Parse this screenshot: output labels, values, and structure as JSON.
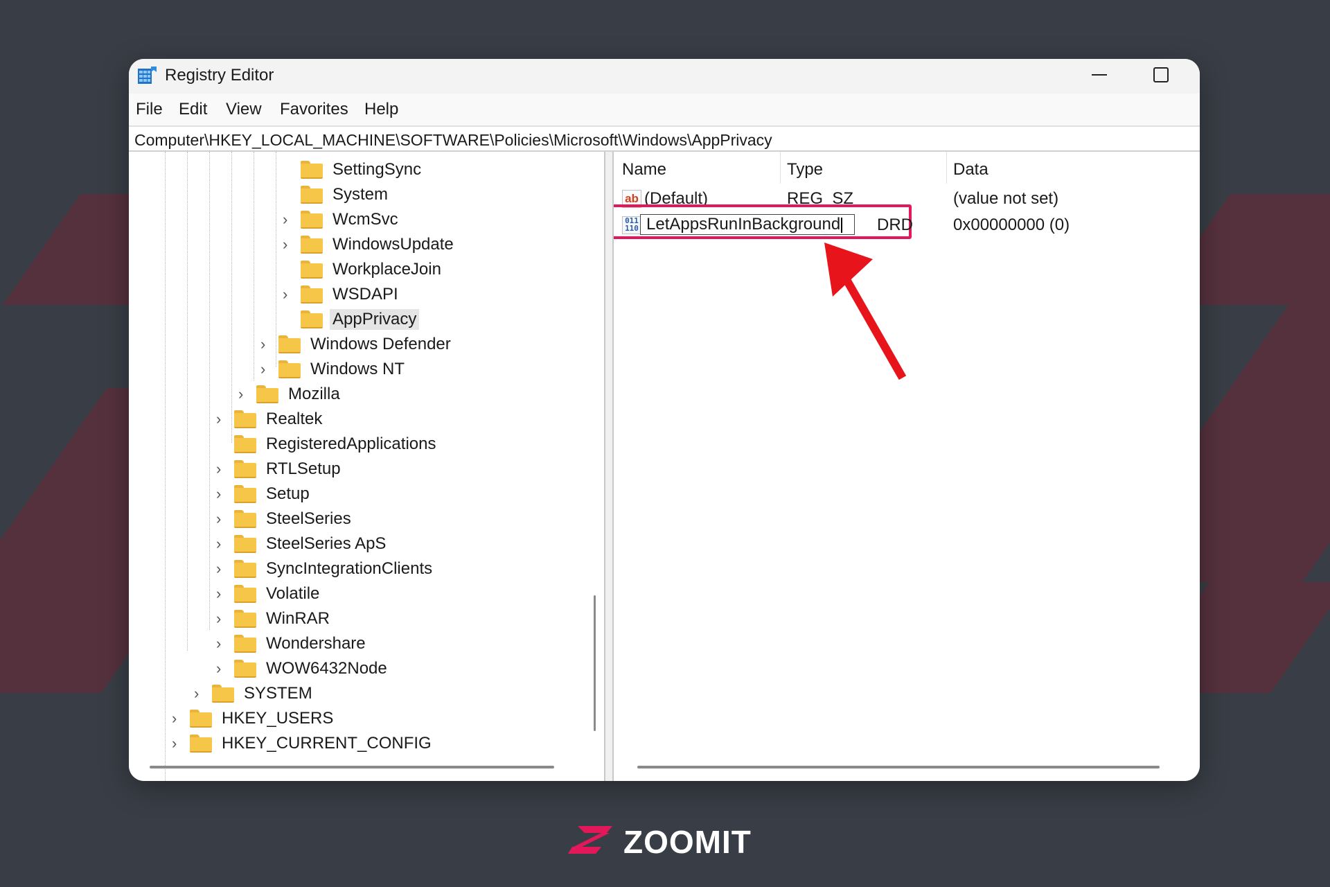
{
  "window": {
    "title": "Registry Editor"
  },
  "menu": [
    "File",
    "Edit",
    "View",
    "Favorites",
    "Help"
  ],
  "address": "Computer\\HKEY_LOCAL_MACHINE\\SOFTWARE\\Policies\\Microsoft\\Windows\\AppPrivacy",
  "tree": [
    {
      "label": "SettingSync",
      "expandable": false
    },
    {
      "label": "System",
      "expandable": false
    },
    {
      "label": "WcmSvc",
      "expandable": true
    },
    {
      "label": "WindowsUpdate",
      "expandable": true
    },
    {
      "label": "WorkplaceJoin",
      "expandable": false
    },
    {
      "label": "WSDAPI",
      "expandable": true
    },
    {
      "label": "AppPrivacy",
      "expandable": false,
      "selected": true
    },
    {
      "label": "Windows Defender",
      "expandable": true
    },
    {
      "label": "Windows NT",
      "expandable": true
    },
    {
      "label": "Mozilla",
      "expandable": true
    },
    {
      "label": "Realtek",
      "expandable": true
    },
    {
      "label": "RegisteredApplications",
      "expandable": false
    },
    {
      "label": "RTLSetup",
      "expandable": true
    },
    {
      "label": "Setup",
      "expandable": true
    },
    {
      "label": "SteelSeries",
      "expandable": true
    },
    {
      "label": "SteelSeries ApS",
      "expandable": true
    },
    {
      "label": "SyncIntegrationClients",
      "expandable": true
    },
    {
      "label": "Volatile",
      "expandable": true
    },
    {
      "label": "WinRAR",
      "expandable": true
    },
    {
      "label": "Wondershare",
      "expandable": true
    },
    {
      "label": "WOW6432Node",
      "expandable": true
    },
    {
      "label": "SYSTEM",
      "expandable": true
    },
    {
      "label": "HKEY_USERS",
      "expandable": true
    },
    {
      "label": "HKEY_CURRENT_CONFIG",
      "expandable": true
    }
  ],
  "list": {
    "columns": {
      "name": "Name",
      "type": "Type",
      "data": "Data"
    },
    "rows": [
      {
        "icon": "string-value-icon",
        "icon_text": "ab",
        "name": "(Default)",
        "type": "REG_SZ",
        "data": "(value not set)"
      },
      {
        "icon": "dword-value-icon",
        "icon_text": "011\n110",
        "name": "LetAppsRunInBackground",
        "type": "DRD",
        "data": "0x00000000 (0)",
        "editing": true
      }
    ]
  },
  "brand": {
    "name": "ZOOMIT",
    "accent": "#e2185a"
  },
  "colors": {
    "background": "#393e46",
    "highlight": "#e2185a",
    "arrow": "#e8141c"
  }
}
